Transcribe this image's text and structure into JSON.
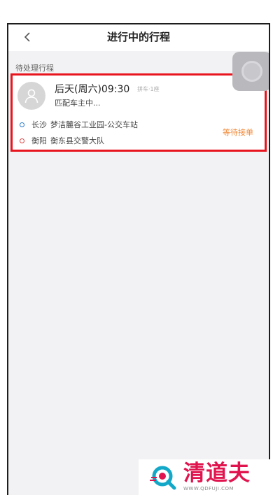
{
  "nav": {
    "title": "进行中的行程",
    "back_icon": "chevron-left-icon"
  },
  "section": {
    "label": "待处理行程"
  },
  "floating_button": {
    "icon": "assistive-touch-icon"
  },
  "trip": {
    "avatar_icon": "user-avatar-icon",
    "time": "后天(周六)09:30",
    "tag": "拼车·1座",
    "status": "匹配车主中...",
    "from": {
      "city": "长沙",
      "place": "梦洁麓谷工业园-公交车站"
    },
    "to": {
      "city": "衡阳",
      "place": "衡东县交警大队"
    },
    "action": "等待接单"
  },
  "watermark": {
    "text": "清道夫",
    "url": "WWW.QDFUJI.COM"
  },
  "colors": {
    "highlight_border": "#e8141e",
    "from_dot": "#2b7ccd",
    "to_dot": "#e04848",
    "action": "#f08a3a",
    "watermark": "#e0144e"
  }
}
